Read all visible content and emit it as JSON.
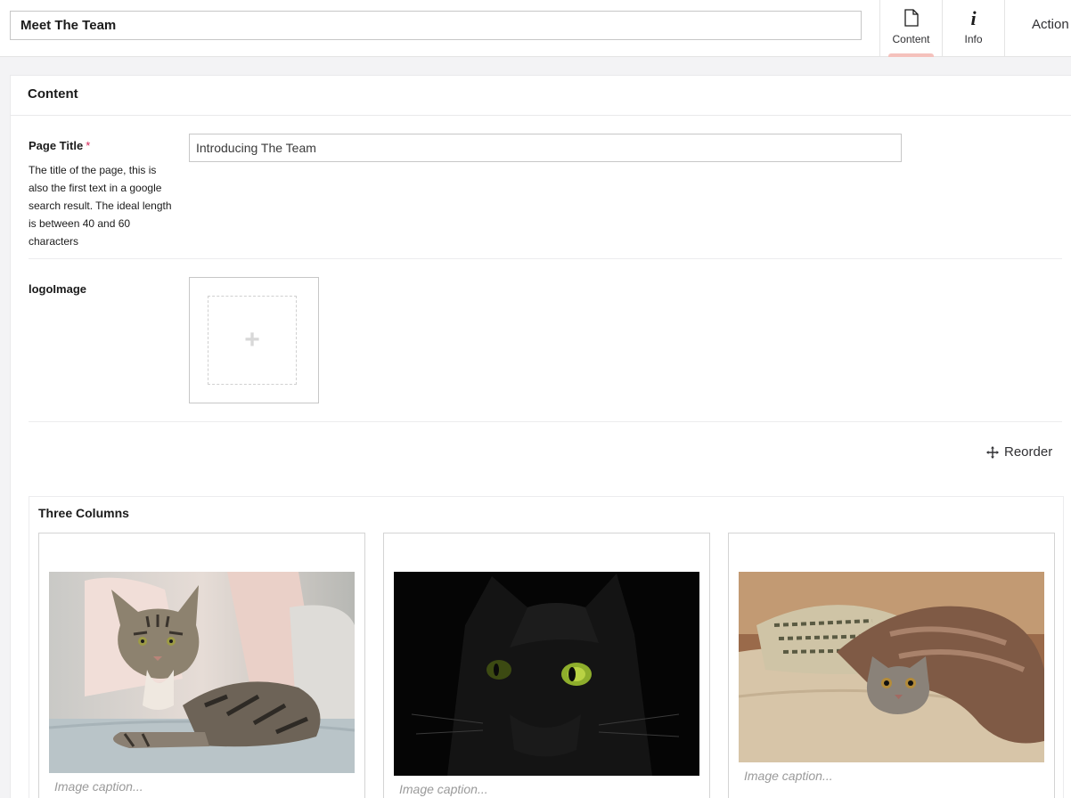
{
  "header": {
    "node_name": "Meet The Team",
    "apps": [
      {
        "label": "Content",
        "icon": "document-icon",
        "active": true
      },
      {
        "label": "Info",
        "icon": "info-icon",
        "active": false
      }
    ],
    "actions_label": "Action"
  },
  "group": {
    "title": "Content"
  },
  "properties": {
    "page_title": {
      "label": "Page Title",
      "required_mark": "*",
      "description": "The title of the page, this is also the first text in a google search result. The ideal length is between 40 and 60 characters",
      "value": "Introducing The Team"
    },
    "logo_image": {
      "label": "logoImage"
    }
  },
  "block_list": {
    "reorder_label": "Reorder",
    "block": {
      "title": "Three Columns",
      "columns": [
        {
          "image": "tabby-cat-on-sofa",
          "caption_placeholder": "Image caption..."
        },
        {
          "image": "black-cat-green-eyes",
          "caption_placeholder": "Image caption..."
        },
        {
          "image": "kitten-under-blanket",
          "caption_placeholder": "Image caption..."
        }
      ]
    }
  },
  "colors": {
    "active_tab_indicator": "#f5c1bc",
    "required": "#d42054",
    "page_background": "#f3f3f5"
  }
}
